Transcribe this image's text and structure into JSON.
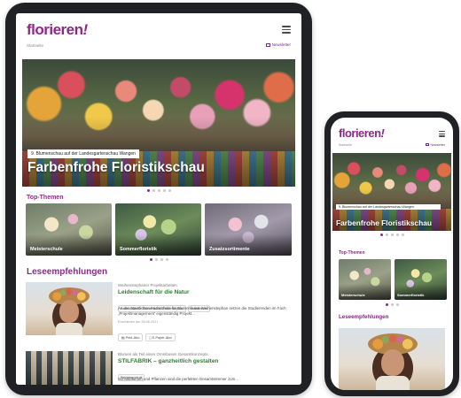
{
  "brand": {
    "logo_text": "florieren",
    "logo_mark": "!",
    "accent": "#8c2a87",
    "title_green": "#2e7d32"
  },
  "tablet": {
    "header": {
      "breadcrumb": "Startseite",
      "newsletter": "Newsletter",
      "menu_icon": "hamburger-menu-icon",
      "newsletter_icon": "envelope-icon"
    },
    "hero": {
      "tag": "9. Blumenschau auf der Landesgartenschau Wangen",
      "title": "Farbenfrohe Floristikschau"
    },
    "top_themen": {
      "title": "Top-Themen",
      "tiles": [
        {
          "label": "Meisterschule"
        },
        {
          "label": "Sommerfloristik"
        },
        {
          "label": "Zusatzsortimente"
        }
      ]
    },
    "lese": {
      "title": "Leseempfehlungen",
      "articles": [
        {
          "kicker": "Weihenstephaner Projektarbeiten",
          "title": "Leidenschaft für die Natur",
          "chips": [
            "Fachschule für Blumenkunst Weihenstephan",
            "Meisterkurs"
          ],
          "body": "An der Staatlichen Fachschule für Blumenkunst Weihenstephan setzen die Studierenden im Fach „Projektmanagement“ eigenständig Projekt...",
          "date": "Erschienen am 28.06.2021",
          "actions": [
            "Print-Abo",
            "E-Paper-Abo"
          ]
        },
        {
          "kicker": "Blumen als Teil eines Omnibusen Gesamtkonzepts",
          "title": "STILFABRIK – ganzheitlich gestalten",
          "chips": [
            "Betriebsportrait"
          ],
          "body": "Schnittblumen und Pflanzen sind die perfekten Gesamtstimmer zum..."
        }
      ]
    }
  },
  "phone": {
    "header": {
      "breadcrumb": "Startseite",
      "newsletter": "Newsletter"
    },
    "hero": {
      "tag": "9. Blumenschau auf der Landesgartenschau Wangen",
      "title": "Farbenfrohe Floristikschau"
    },
    "top_themen": {
      "title": "Top-Themen",
      "tiles": [
        {
          "label": "Meisterschule"
        },
        {
          "label": "Sommerfloristik"
        }
      ]
    },
    "lese": {
      "title": "Leseempfehlungen"
    }
  }
}
